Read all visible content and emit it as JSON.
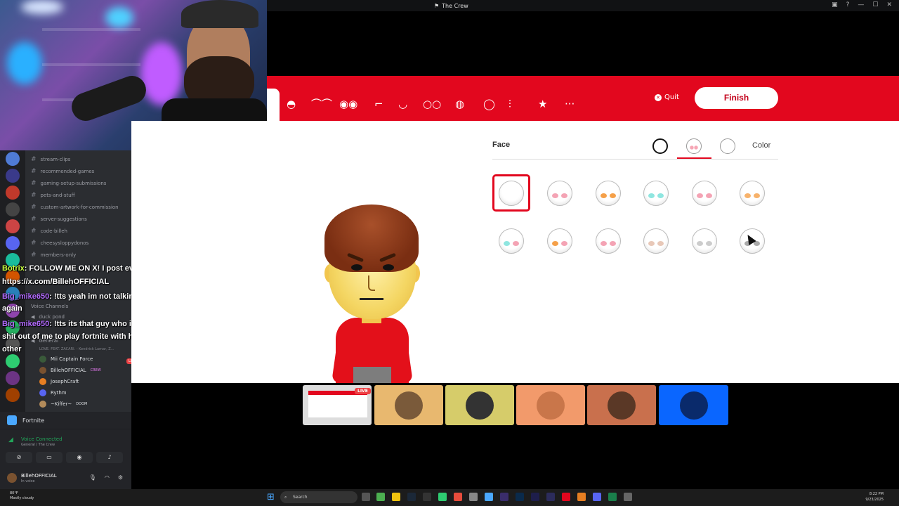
{
  "window": {
    "title": "The Crew"
  },
  "discord": {
    "channels": [
      "stream-clips",
      "recommended-games",
      "gaming-setup-submissions",
      "pets-and-stuff",
      "custom-artwork-for-commission",
      "server-suggestions",
      "code-billeh",
      "cheesysloppydonos",
      "members-only"
    ],
    "voice_channels_label": "Voice Channels",
    "voice_channel_1": "duck pond",
    "voice_channel_2": "General",
    "now_playing": "LOVE. FEAT. ZACARI. - Kendrick Lamar, Z...",
    "voice_users": [
      {
        "name": "Mii Captain Force",
        "badge": "LIVE"
      },
      {
        "name": "BillehOFFICIAL",
        "badge": "CREW"
      },
      {
        "name": "JosephCraft",
        "badge": ""
      },
      {
        "name": "Rythm",
        "badge": ""
      },
      {
        "name": "~Kiffer~",
        "badge": "DOOM"
      }
    ],
    "activity": "Fortnite",
    "voice_status": "Voice Connected",
    "voice_location": "General / The Crew",
    "user": {
      "name": "BillehOFFICIAL",
      "status": "In voice"
    }
  },
  "chat": [
    {
      "nick": "Botrix",
      "text": ": FOLLOW ME ON X! I post everyday."
    },
    {
      "nick": "",
      "text": "https://x.com/BillehOFFICIAL"
    },
    {
      "nick": "Big_mike650",
      "text": ": !tts yeah im not talking to that piece of shit"
    },
    {
      "nick": "",
      "text": "again"
    },
    {
      "nick": "Big_mike650",
      "text": ": !tts its that guy who i told you would bother the"
    },
    {
      "nick": "",
      "text": "shit out of me to play fortnite with him only for us to just shoot at each"
    },
    {
      "nick": "",
      "text": "other"
    }
  ],
  "mii_editor": {
    "quit_label": "Quit",
    "finish_label": "Finish",
    "section_title": "Face",
    "color_tab_label": "Color",
    "face_options": [
      {
        "l": "#ffffff",
        "r": "#ffffff"
      },
      {
        "l": "#f4a3b4",
        "r": "#f4a3b4"
      },
      {
        "l": "#f5a049",
        "r": "#f5a049"
      },
      {
        "l": "#8fe6e0",
        "r": "#8fe6e0"
      },
      {
        "l": "#f4a3b4",
        "r": "#f4a3b4"
      },
      {
        "l": "#f7b26b",
        "r": "#f7b26b"
      },
      {
        "l": "#8fe6e0",
        "r": "#f4a3b4"
      },
      {
        "l": "#f5a049",
        "r": "#f4a3b4"
      },
      {
        "l": "#f4a3b4",
        "r": "#f4a3b4"
      },
      {
        "l": "#e8c8b8",
        "r": "#e8c8b8"
      },
      {
        "l": "#cccccc",
        "r": "#cccccc"
      },
      {
        "l": "#aaaaaa",
        "r": "#aaaaaa"
      }
    ],
    "colors": {
      "header_red": "#e2071e",
      "selected": "#e2071e"
    }
  },
  "stream_tiles": {
    "live_label": "LIVE"
  },
  "taskbar": {
    "weather_temp": "80°F",
    "weather_desc": "Mostly cloudy",
    "search_placeholder": "Search",
    "time": "8:22 PM",
    "date": "9/23/2025"
  }
}
